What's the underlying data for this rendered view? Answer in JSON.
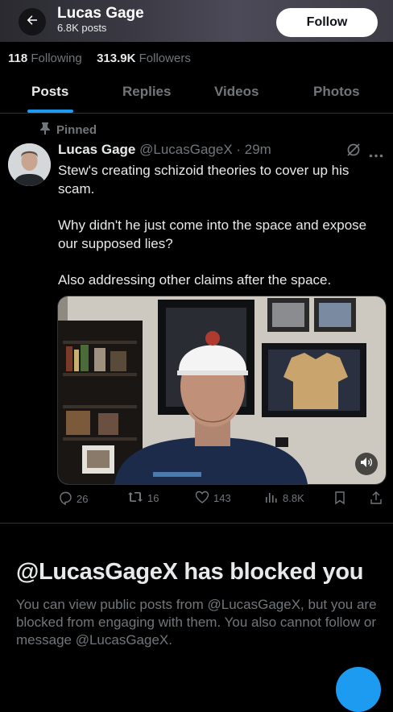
{
  "header": {
    "name": "Lucas Gage",
    "posts_count": "6.8K posts",
    "follow_label": "Follow"
  },
  "stats": {
    "following_count": "118",
    "following_label": "Following",
    "followers_count": "313.9K",
    "followers_label": "Followers"
  },
  "tabs": [
    "Posts",
    "Replies",
    "Videos",
    "Photos"
  ],
  "active_tab": "Posts",
  "post": {
    "pinned_label": "Pinned",
    "author_name": "Lucas Gage",
    "handle_time": "@LucasGageX · 29m",
    "paragraphs": [
      "Stew's creating schizoid theories to cover up his scam.",
      "Why didn't he just come into the space and expose our supposed lies?",
      "Also addressing other claims after the space."
    ],
    "replies": "26",
    "reposts": "16",
    "likes": "143",
    "views": "8.8K"
  },
  "blocked": {
    "title": "@LucasGageX has blocked you",
    "message": "You can view public posts from @LucasGageX, but you are blocked from engaging with them. You also cannot follow or message @LucasGageX."
  },
  "colors": {
    "accent": "#1d9bf0",
    "muted": "#71767b",
    "text": "#e7e9ea",
    "background": "#000000"
  }
}
